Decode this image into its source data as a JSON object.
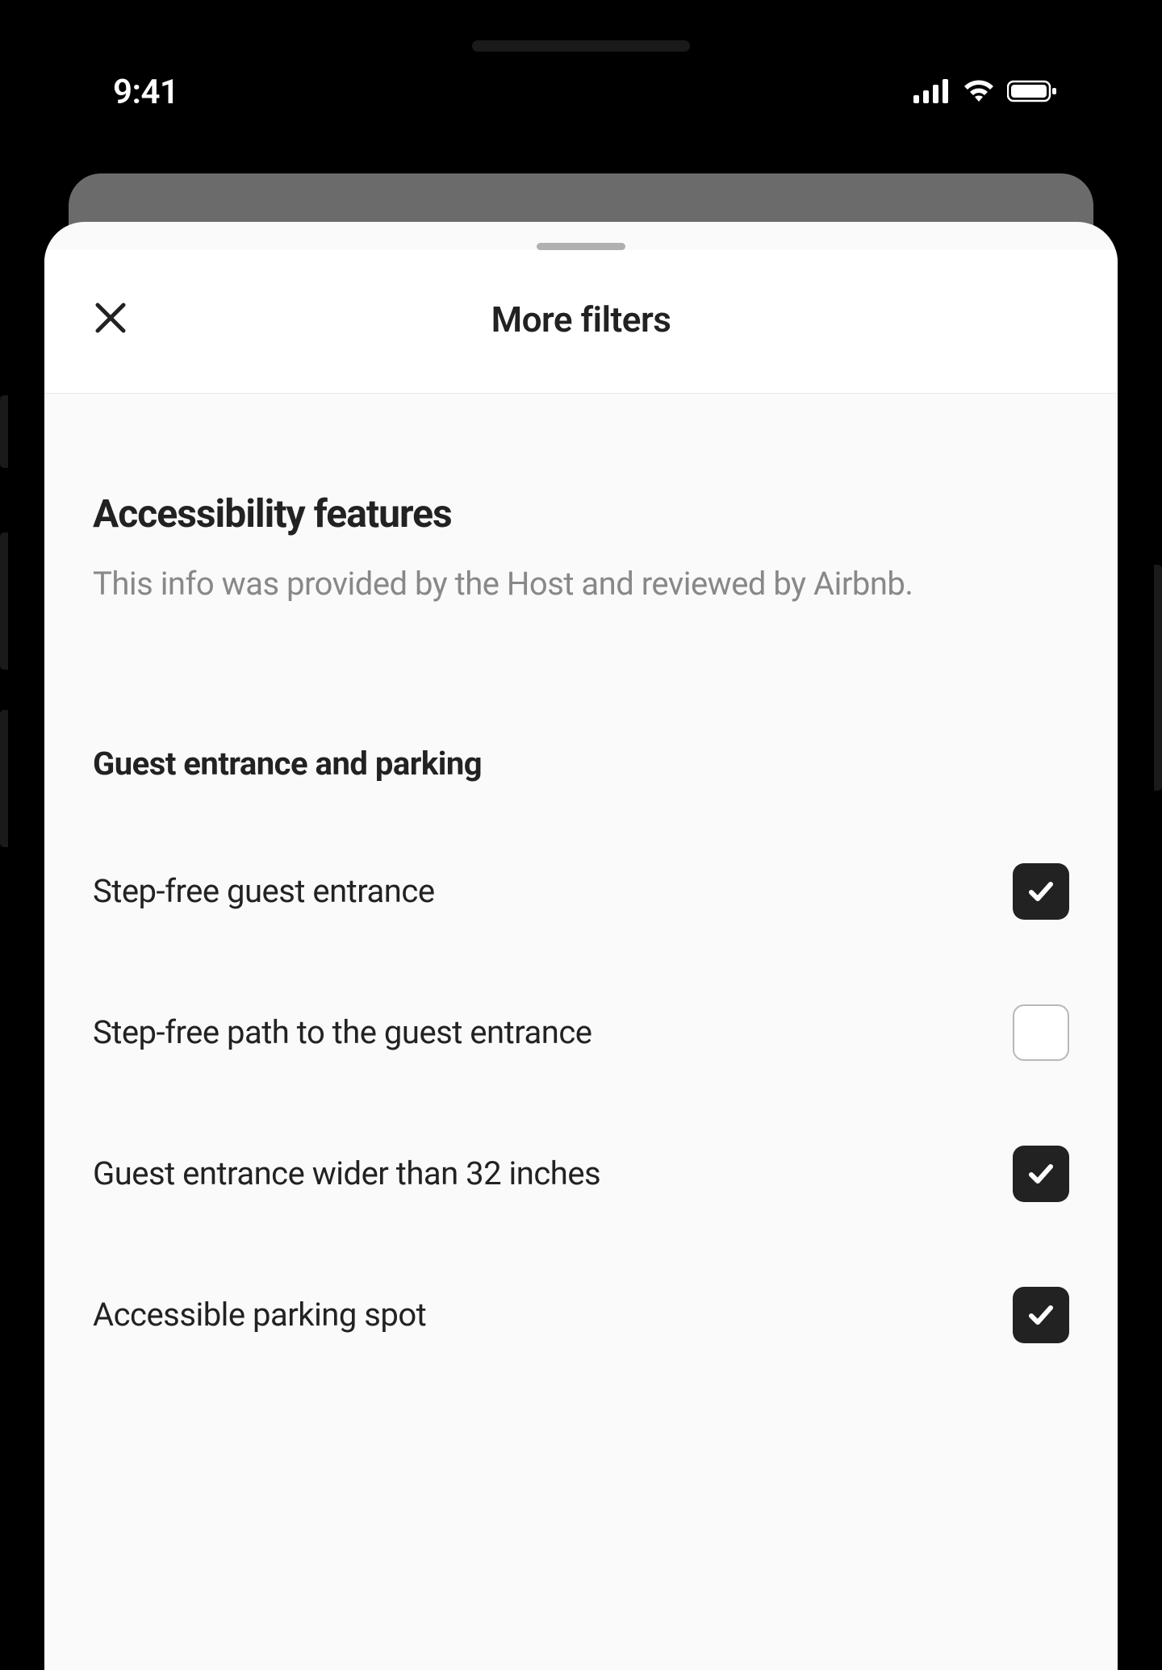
{
  "status": {
    "time": "9:41"
  },
  "sheet": {
    "title": "More filters"
  },
  "section": {
    "title": "Accessibility features",
    "subtitle": "This info was provided by the Host and reviewed by Airbnb."
  },
  "group": {
    "title": "Guest entrance and parking",
    "items": [
      {
        "label": "Step-free guest entrance",
        "checked": true
      },
      {
        "label": "Step-free path to the guest entrance",
        "checked": false
      },
      {
        "label": "Guest entrance wider than 32 inches",
        "checked": true
      },
      {
        "label": "Accessible parking spot",
        "checked": true
      }
    ]
  }
}
